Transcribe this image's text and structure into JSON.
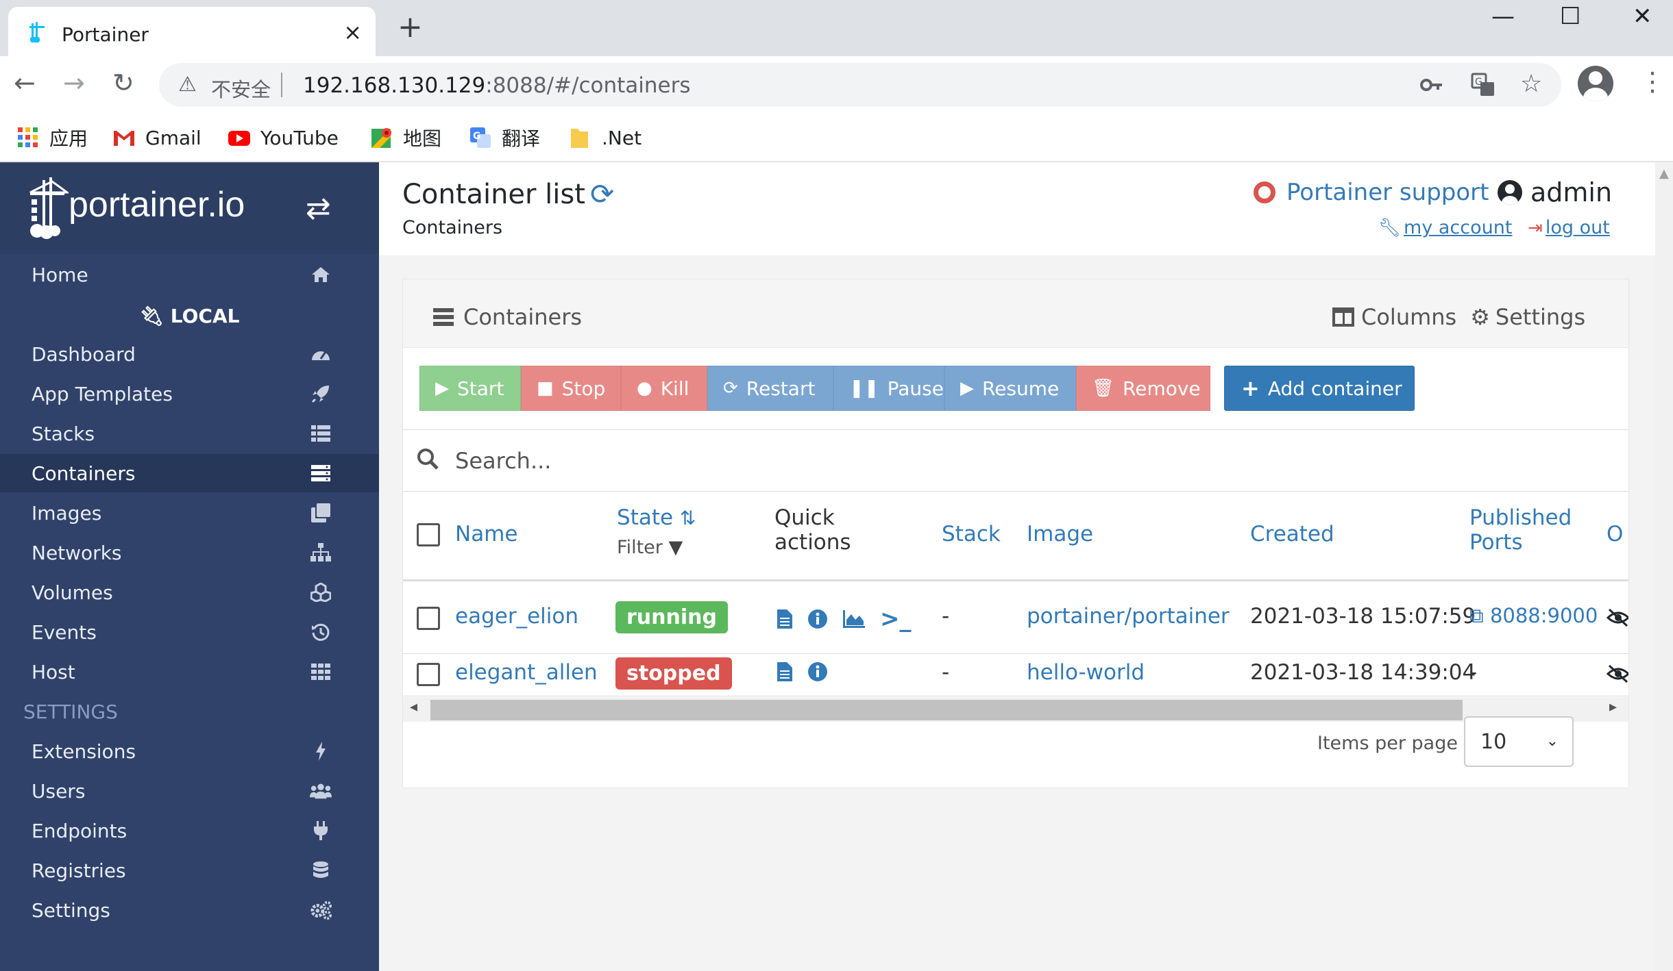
{
  "browser": {
    "tab_title": "Portainer",
    "tab_close": "×",
    "new_tab": "+",
    "window_controls": {
      "minimize": "—",
      "maximize": "☐",
      "close": "✕"
    },
    "nav": {
      "back": "←",
      "forward": "→",
      "reload": "↻"
    },
    "address": {
      "security_label": "不安全",
      "host": "192.168.130.129",
      "rest": ":8088/#/containers"
    },
    "bookmarks": [
      {
        "label": "应用",
        "icon": "apps-grid-icon"
      },
      {
        "label": "Gmail",
        "icon": "gmail-icon"
      },
      {
        "label": "YouTube",
        "icon": "youtube-icon"
      },
      {
        "label": "地图",
        "icon": "maps-icon"
      },
      {
        "label": "翻译",
        "icon": "translate-icon"
      },
      {
        "label": ".Net",
        "icon": "folder-icon"
      }
    ]
  },
  "sidebar": {
    "brand": "portainer.io",
    "home": "Home",
    "endpoint": "LOCAL",
    "items": [
      {
        "label": "Dashboard",
        "icon": "tachometer-icon"
      },
      {
        "label": "App Templates",
        "icon": "rocket-icon"
      },
      {
        "label": "Stacks",
        "icon": "th-list-icon"
      },
      {
        "label": "Containers",
        "icon": "server-icon",
        "active": true
      },
      {
        "label": "Images",
        "icon": "clone-icon"
      },
      {
        "label": "Networks",
        "icon": "sitemap-icon"
      },
      {
        "label": "Volumes",
        "icon": "cubes-icon"
      },
      {
        "label": "Events",
        "icon": "history-icon"
      },
      {
        "label": "Host",
        "icon": "th-icon"
      }
    ],
    "settings_heading": "SETTINGS",
    "settings_items": [
      {
        "label": "Extensions",
        "icon": "bolt-icon"
      },
      {
        "label": "Users",
        "icon": "users-icon"
      },
      {
        "label": "Endpoints",
        "icon": "plug-icon"
      },
      {
        "label": "Registries",
        "icon": "database-icon"
      },
      {
        "label": "Settings",
        "icon": "cogs-icon"
      }
    ]
  },
  "header": {
    "title": "Container list",
    "breadcrumb": "Containers",
    "support": "Portainer support",
    "user": "admin",
    "my_account": "my account",
    "log_out": "log out"
  },
  "panel": {
    "title": "Containers",
    "columns_label": "Columns",
    "settings_label": "Settings",
    "buttons": {
      "start": "Start",
      "stop": "Stop",
      "kill": "Kill",
      "restart": "Restart",
      "pause": "Pause",
      "resume": "Resume",
      "remove": "Remove",
      "add": "Add container"
    },
    "search_placeholder": "Search...",
    "columns": {
      "name": "Name",
      "state": "State",
      "filter": "Filter",
      "quick_1": "Quick",
      "quick_2": "actions",
      "stack": "Stack",
      "image": "Image",
      "created": "Created",
      "published_1": "Published",
      "published_2": "Ports",
      "ownership": "O"
    },
    "rows": [
      {
        "name": "eager_elion",
        "state": "running",
        "stack": "-",
        "image": "portainer/portainer",
        "created": "2021-03-18 15:07:59",
        "ports": "8088:9000"
      },
      {
        "name": "elegant_allen",
        "state": "stopped",
        "stack": "-",
        "image": "hello-world",
        "created": "2021-03-18 14:39:04",
        "ports": "-"
      }
    ],
    "items_per_page_label": "Items per page",
    "items_per_page": "10"
  },
  "colors": {
    "sidebar_bg": "#30426a",
    "link": "#337ab7",
    "success": "#5cb85c",
    "danger": "#d9534f"
  }
}
